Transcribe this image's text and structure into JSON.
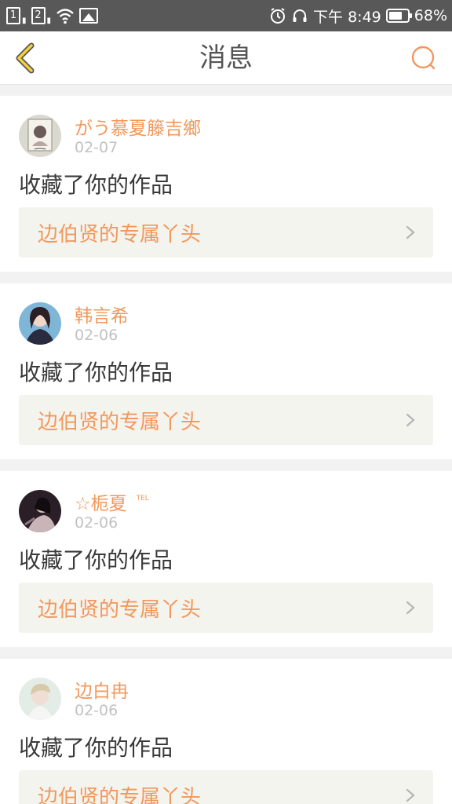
{
  "status_bar": {
    "sim1": "1",
    "sim2": "2",
    "time": "下午 8:49",
    "battery": "68%",
    "battery_level": 0.68
  },
  "header": {
    "title": "消息"
  },
  "colors": {
    "accent": "#f2985c",
    "back_arrow": "#f4d03f",
    "card_inner": "#f4f4ee"
  },
  "messages": [
    {
      "user": "がう慕夏籐吉鄉",
      "date": "02-07",
      "action": "收藏了你的作品",
      "work": "边伯贤的专属丫头",
      "avatar": "avatar-1"
    },
    {
      "user": "韩言希",
      "date": "02-06",
      "action": "收藏了你的作品",
      "work": "边伯贤的专属丫头",
      "avatar": "avatar-2"
    },
    {
      "user": "☆栀夏",
      "user_badge": "TEL",
      "date": "02-06",
      "action": "收藏了你的作品",
      "work": "边伯贤的专属丫头",
      "avatar": "avatar-3"
    },
    {
      "user": "边白冉",
      "date": "02-06",
      "action": "收藏了你的作品",
      "work": "边伯贤的专属丫头",
      "avatar": "avatar-4"
    }
  ]
}
